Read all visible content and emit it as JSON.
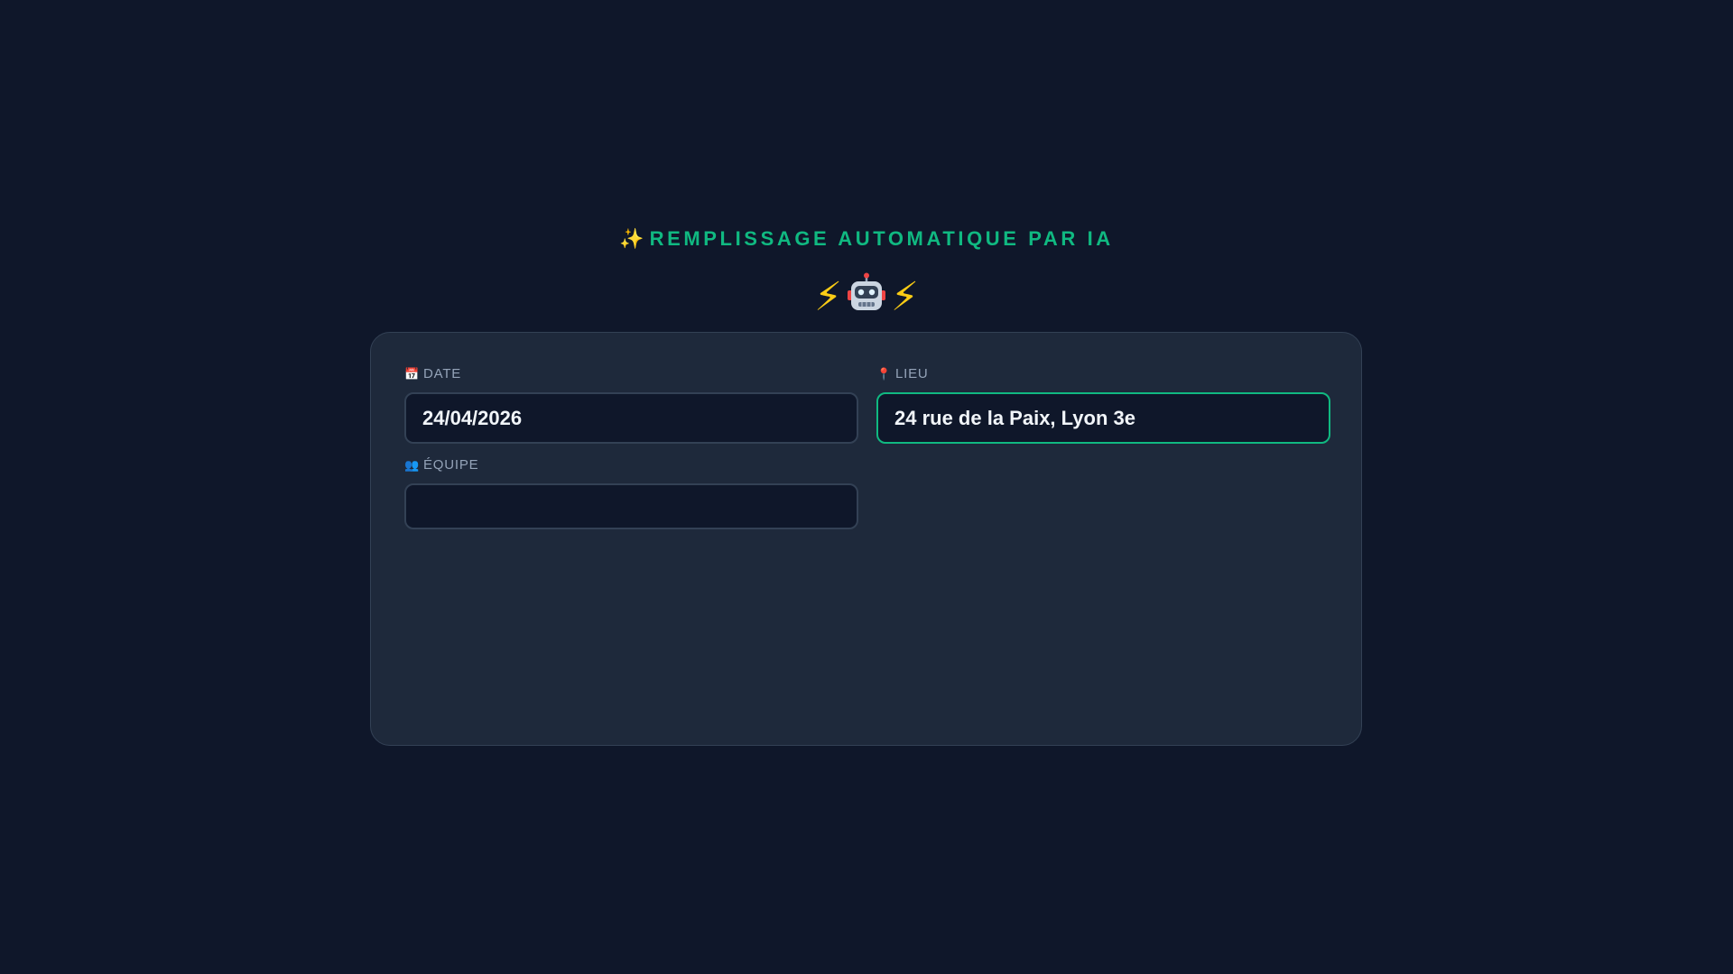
{
  "header": {
    "title": "REMPLISSAGE AUTOMATIQUE PAR IA",
    "title_icon": "sparkles-icon",
    "emoji_row": [
      "lightning-icon",
      "robot-icon",
      "lightning-icon"
    ]
  },
  "form": {
    "date": {
      "label": "DATE",
      "icon": "calendar-icon",
      "value": "24/04/2026"
    },
    "lieu": {
      "label": "LIEU",
      "icon": "map-pin-icon",
      "value": "24 rue de la Paix, Lyon 3e"
    },
    "equipe": {
      "label": "ÉQUIPE",
      "icon": "team-icon",
      "value": ""
    }
  },
  "colors": {
    "background": "#0f172a",
    "card": "#1e293b",
    "accent": "#10b981",
    "label": "#94a3b8",
    "input_border": "#334155"
  }
}
